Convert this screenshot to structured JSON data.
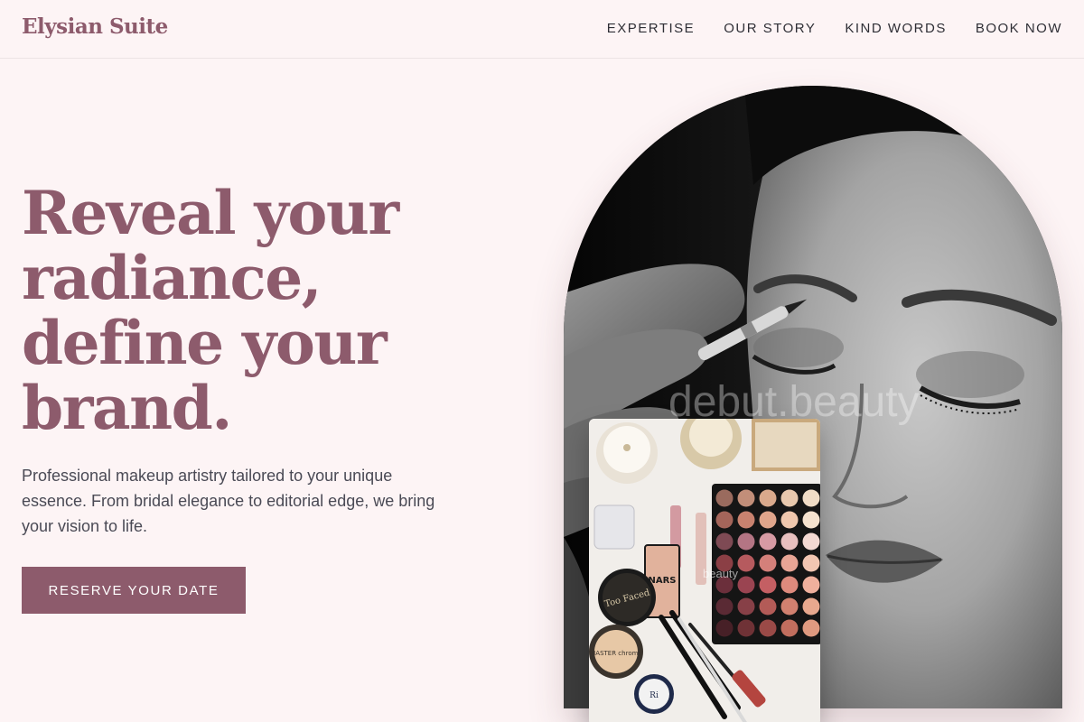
{
  "nav": {
    "brand": "Elysian Suite",
    "links": [
      "EXPERTISE",
      "OUR STORY",
      "KIND WORDS",
      "BOOK NOW"
    ]
  },
  "hero": {
    "headline_lines": [
      "Reveal your",
      "radiance,",
      "define your",
      "brand."
    ],
    "description": "Professional makeup artistry tailored to your unique essence. From bridal elegance to editorial edge, we bring your vision to life.",
    "cta_label": "RESERVE YOUR DATE"
  },
  "images": {
    "main_watermark": "debut.beauty",
    "inset_watermark": "beauty",
    "product_labels": [
      "Too Faced",
      "NARS",
      "MASTER chrome",
      "Ri"
    ]
  },
  "colors": {
    "accent": "#8d5b6c",
    "background": "#fdf4f5",
    "text": "#4a4a55",
    "nav_text": "#2f2f36"
  }
}
